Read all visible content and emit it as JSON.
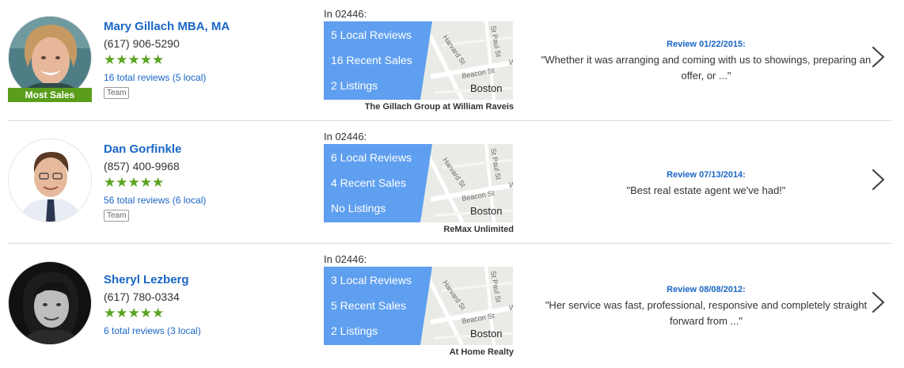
{
  "agents": [
    {
      "name": "Mary Gillach MBA, MA",
      "phone": "(617) 906-5290",
      "rating_stars": "★★★★★",
      "rating": 5,
      "total_reviews": "16 total reviews (5 local)",
      "badge": "Most Sales",
      "tag": "Team",
      "zip_label": "In 02446:",
      "stats": [
        "5 Local Reviews",
        "16 Recent Sales",
        "2 Listings"
      ],
      "brokerage": "The Gillach Group at William Raveis",
      "review_date": "Review 01/22/2015:",
      "review_quote": "\"Whether it was arranging and coming with us to showings, preparing an offer, or ...\""
    },
    {
      "name": "Dan Gorfinkle",
      "phone": "(857) 400-9968",
      "rating_stars": "★★★★★",
      "rating": 5,
      "total_reviews": "56 total reviews (6 local)",
      "tag": "Team",
      "zip_label": "In 02446:",
      "stats": [
        "6 Local Reviews",
        "4 Recent Sales",
        "No Listings"
      ],
      "brokerage": "ReMax Unlimited",
      "review_date": "Review 07/13/2014:",
      "review_quote": "\"Best real estate agent we've had!\""
    },
    {
      "name": "Sheryl Lezberg",
      "phone": "(617) 780-0334",
      "rating_stars": "★★★★★",
      "rating": 5,
      "total_reviews": "6 total reviews (3 local)",
      "zip_label": "In 02446:",
      "stats": [
        "3 Local Reviews",
        "5 Recent Sales",
        "2 Listings"
      ],
      "brokerage": "At Home Realty",
      "review_date": "Review 08/08/2012:",
      "review_quote": "\"Her service was fast, professional, responsive and completely straight forward from ...\""
    }
  ],
  "map": {
    "street_labels": [
      "Harvard St",
      "St Paul St",
      "Beacon St",
      "W"
    ],
    "city_label": "Boston"
  },
  "colors": {
    "link": "#1a66c6",
    "stars": "#5aa321",
    "badge": "#5a9e1b",
    "stats_panel": "#5f9ff0",
    "divider": "#d9d9d9"
  },
  "icons": [
    "chevron-right-icon",
    "star-icon"
  ]
}
